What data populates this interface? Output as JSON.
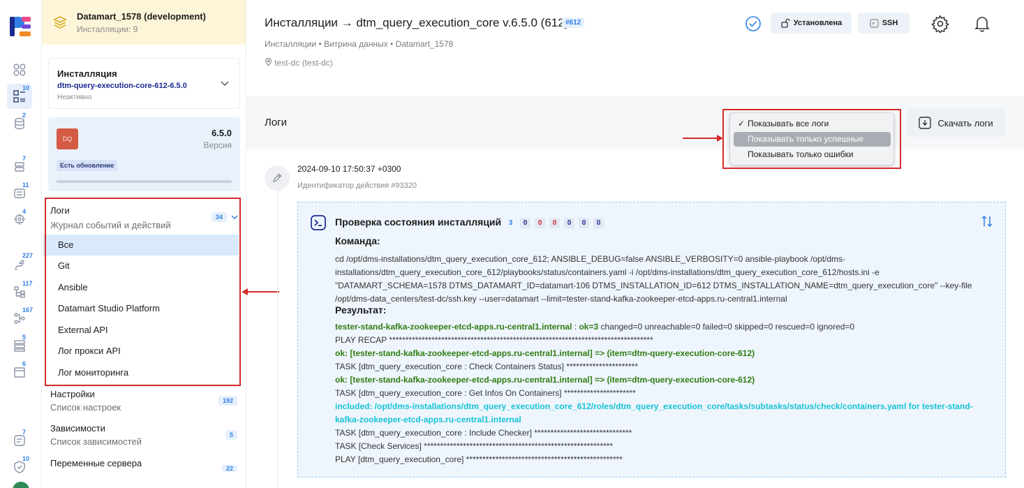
{
  "rail": {
    "badges": [
      "10",
      "2",
      "7",
      "11",
      "4",
      "227",
      "117",
      "167",
      "5",
      "6",
      "7",
      "10"
    ]
  },
  "datamart": {
    "title": "Datamart_1578 (development)",
    "subtitle": "Инсталляции: 9"
  },
  "installation": {
    "label": "Инсталляция",
    "value": "dtm-query-execution-core-612-6.5.0",
    "state": "Неактивно"
  },
  "version": {
    "logo": "DQ",
    "number": "6.5.0",
    "label": "Версия",
    "badge": "Есть обновление"
  },
  "logs_menu": {
    "title": "Логи",
    "subtitle": "Журнал событий и действий",
    "count": "34",
    "items": [
      "Все",
      "Git",
      "Ansible",
      "Datamart Studio Platform",
      "External API",
      "Лог прокси API",
      "Лог мониторинга"
    ]
  },
  "sections": [
    {
      "title": "Настройки",
      "subtitle": "Список настроек",
      "count": "192"
    },
    {
      "title": "Зависимости",
      "subtitle": "Список зависимостей",
      "count": "5"
    },
    {
      "title": "Переменные сервера",
      "subtitle": "",
      "count": "22"
    }
  ],
  "header": {
    "title": "Инсталляции → dtm_query_execution_core v.6.5.0 (612)",
    "tag": "#612",
    "breadcrumbs": "Инсталляции • Витрина данных • Datamart_1578",
    "location": "test-dc (test-dc)",
    "installed_label": "Установлена",
    "ssh_label": "SSH"
  },
  "logs_bar": {
    "title": "Логи",
    "download_label": "Скачать логи"
  },
  "filter_dropdown": {
    "items": [
      "Показывать все логи",
      "Показывать только успешные",
      "Показывать только ошибки"
    ],
    "checked": "✓"
  },
  "entry": {
    "timestamp": "2024-09-10 17:50:37 +0300",
    "action_id": "Идентификатор действия #93320",
    "title": "Проверка состояния инсталляций",
    "counters": [
      {
        "value": "3",
        "color": "#2f7ee6"
      },
      {
        "value": "0",
        "color": "#1b2a8f"
      },
      {
        "value": "0",
        "color": "#d42a2a"
      },
      {
        "value": "0",
        "color": "#d42a2a"
      },
      {
        "value": "0",
        "color": "#1b2a8f"
      },
      {
        "value": "0",
        "color": "#1b2a8f"
      },
      {
        "value": "0",
        "color": "#1b2a8f"
      }
    ],
    "command_heading": "Команда:",
    "command_lines": [
      "cd /opt/dms-installations/dtm_query_execution_core_612; ANSIBLE_DEBUG=false ANSIBLE_VERBOSITY=0 ansible-playbook /opt/dms-",
      "installations/dtm_query_execution_core_612/playbooks/status/containers.yaml -i /opt/dms-installations/dtm_query_execution_core_612/hosts.ini -e",
      "\"DATAMART_SCHEMA=1578 DTMS_DATAMART_ID=datamart-106 DTMS_INSTALLATION_ID=612 DTMS_INSTALLATION_NAME=dtm_query_execution_core\" --key-file",
      "/opt/dms-data_centers/test-dc/ssh.key --user=datamart --limit=tester-stand-kafka-zookeeper-etcd-apps.ru-central1.internal"
    ],
    "result_heading": "Результат:",
    "recap_host": "tester-stand-kafka-zookeeper-etcd-apps.ru-central1.internal",
    "recap_sep": " : ",
    "recap_ok": "ok=3",
    "recap_rest": " changed=0 unreachable=0 failed=0 skipped=0 rescued=0 ignored=0",
    "result_lines": [
      {
        "style": "n",
        "text": "PLAY RECAP *********************************************************************************"
      },
      {
        "style": "g",
        "text": "ok: [tester-stand-kafka-zookeeper-etcd-apps.ru-central1.internal] => (item=dtm-query-execution-core-612)"
      },
      {
        "style": "n",
        "text": "TASK [dtm_query_execution_core : Check Containers Status] **********************"
      },
      {
        "style": "g",
        "text": "ok: [tester-stand-kafka-zookeeper-etcd-apps.ru-central1.internal] => (item=dtm-query-execution-core-612)"
      },
      {
        "style": "n",
        "text": "TASK [dtm_query_execution_core : Get Infos On Containers] **********************"
      },
      {
        "style": "c",
        "text": "included: /opt/dms-installations/dtm_query_execution_core_612/roles/dtm_query_execution_core/tasks/subtasks/status/check/containers.yaml for tester-stand-"
      },
      {
        "style": "c",
        "text": "kafka-zookeeper-etcd-apps.ru-central1.internal"
      },
      {
        "style": "n",
        "text": "TASK [dtm_query_execution_core : Include Checker] ******************************"
      },
      {
        "style": "n",
        "text": "TASK [Check Services] **********************************************************"
      },
      {
        "style": "n",
        "text": "PLAY [dtm_query_execution_core] ************************************************"
      }
    ]
  },
  "colors": {
    "accent": "#2f7ee6",
    "highlight": "#d42a2a",
    "success": "#2f7d12",
    "info": "#17c3d8"
  }
}
